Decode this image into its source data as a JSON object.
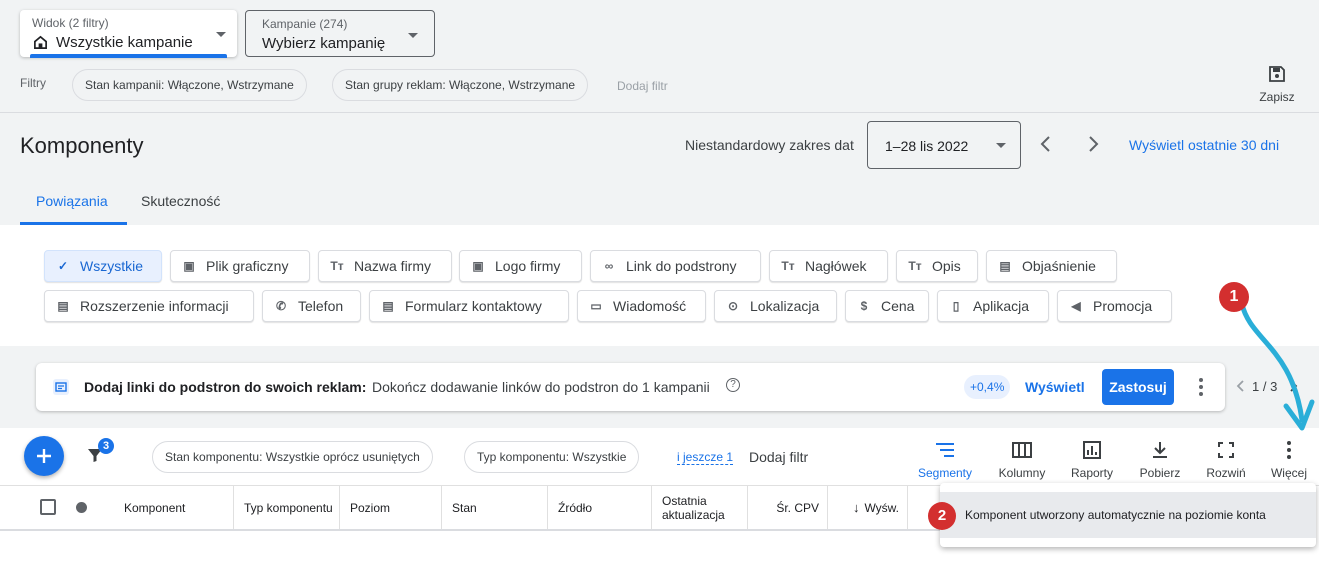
{
  "view": {
    "label": "Widok (2 filtry)",
    "value": "Wszystkie kampanie"
  },
  "campaigns": {
    "label": "Kampanie (274)",
    "value": "Wybierz kampanię"
  },
  "filters": {
    "label": "Filtry",
    "chips": [
      "Stan kampanii: Włączone, Wstrzymane",
      "Stan grupy reklam: Włączone, Wstrzymane"
    ],
    "add": "Dodaj filtr"
  },
  "save_label": "Zapisz",
  "page_title": "Komponenty",
  "date": {
    "label": "Niestandardowy zakres dat",
    "value": "1–28 lis 2022",
    "last30": "Wyświetl ostatnie 30 dni"
  },
  "tabs": [
    "Powiązania",
    "Skuteczność"
  ],
  "asset_types": [
    "Wszystkie",
    "Plik graficzny",
    "Nazwa firmy",
    "Logo firmy",
    "Link do podstrony",
    "Nagłówek",
    "Opis",
    "Objaśnienie",
    "Rozszerzenie informacji",
    "Telefon",
    "Formularz kontaktowy",
    "Wiadomość",
    "Lokalizacja",
    "Cena",
    "Aplikacja",
    "Promocja"
  ],
  "recommendation": {
    "title": "Dodaj linki do podstron do swoich reklam:",
    "text": "Dokończ dodawanie linków do podstron do 1 kampanii",
    "badge": "+0,4%",
    "view": "Wyświetl",
    "apply": "Zastosuj",
    "pager": "1 / 3"
  },
  "toolbar": {
    "filter_count": "3",
    "chips": [
      "Stan komponentu: Wszystkie oprócz usuniętych",
      "Typ komponentu: Wszystkie"
    ],
    "more_filters": "i jeszcze 1",
    "add_filter": "Dodaj filtr",
    "tools": [
      "Segmenty",
      "Kolumny",
      "Raporty",
      "Pobierz",
      "Rozwiń",
      "Więcej"
    ]
  },
  "columns": [
    "Komponent",
    "Typ komponentu",
    "Poziom",
    "Stan",
    "Źródło",
    "Ostatnia aktualizacja",
    "Śr. CPV",
    "Wyśw."
  ],
  "menu": {
    "item": "Komponent utworzony automatycznie na poziomie konta"
  },
  "annotations": [
    "1",
    "2"
  ],
  "colors": {
    "accent": "#1a73e8",
    "annotation": "#d32f2f",
    "arrow": "#2aaed8"
  }
}
